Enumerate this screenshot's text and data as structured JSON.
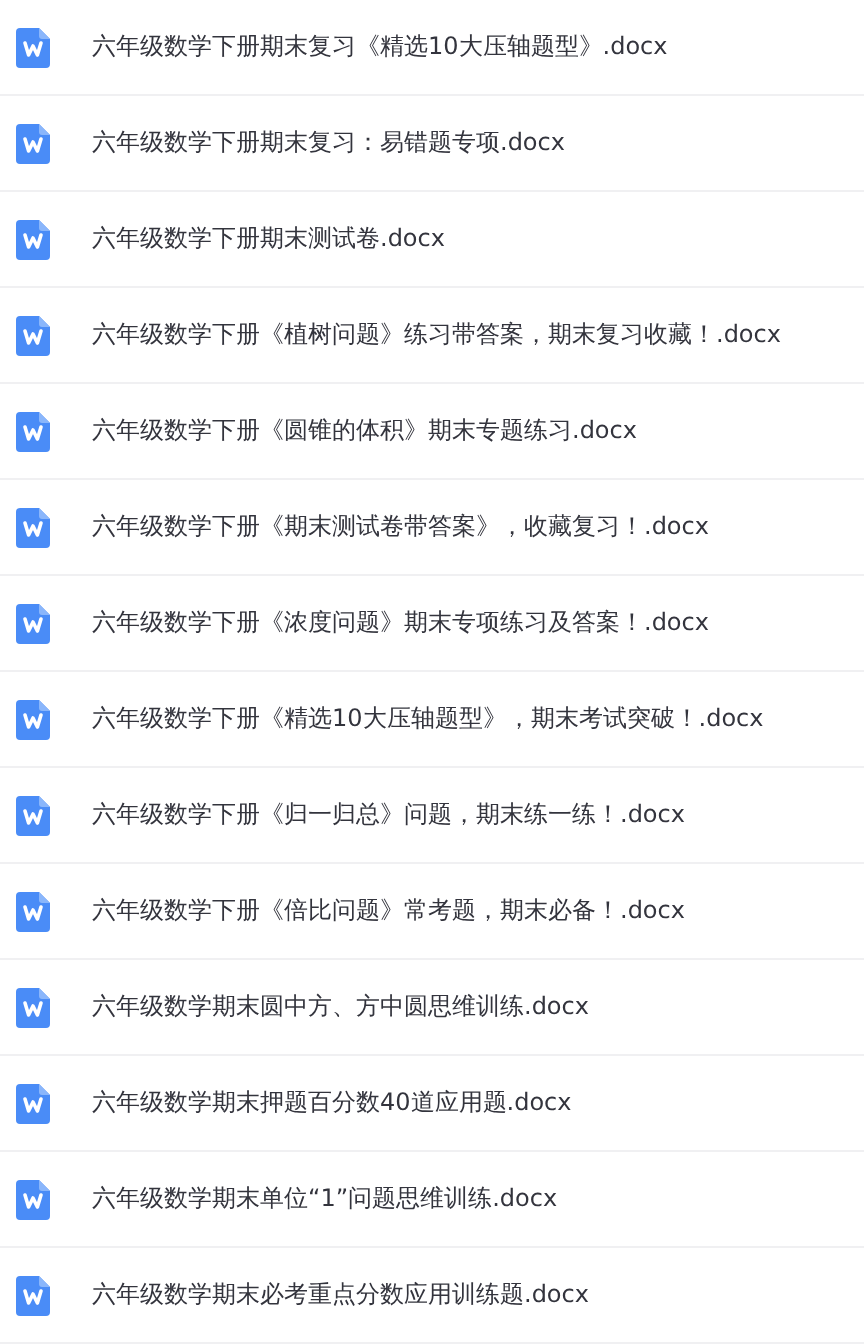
{
  "files": [
    {
      "name": "六年级数学下册期末复习《精选10大压轴题型》.docx"
    },
    {
      "name": "六年级数学下册期末复习：易错题专项.docx"
    },
    {
      "name": "六年级数学下册期末测试卷.docx"
    },
    {
      "name": "六年级数学下册《植树问题》练习带答案，期末复习收藏！.docx"
    },
    {
      "name": "六年级数学下册《圆锥的体积》期末专题练习.docx"
    },
    {
      "name": "六年级数学下册《期末测试卷带答案》，收藏复习！.docx"
    },
    {
      "name": "六年级数学下册《浓度问题》期末专项练习及答案！.docx"
    },
    {
      "name": "六年级数学下册《精选10大压轴题型》，期末考试突破！.docx"
    },
    {
      "name": "六年级数学下册《归一归总》问题，期末练一练！.docx"
    },
    {
      "name": "六年级数学下册《倍比问题》常考题，期末必备！.docx"
    },
    {
      "name": "六年级数学期末圆中方、方中圆思维训练.docx"
    },
    {
      "name": "六年级数学期末押题百分数40道应用题.docx"
    },
    {
      "name": "六年级数学期末单位“1”问题思维训练.docx"
    },
    {
      "name": "六年级数学期末必考重点分数应用训练题.docx"
    }
  ]
}
